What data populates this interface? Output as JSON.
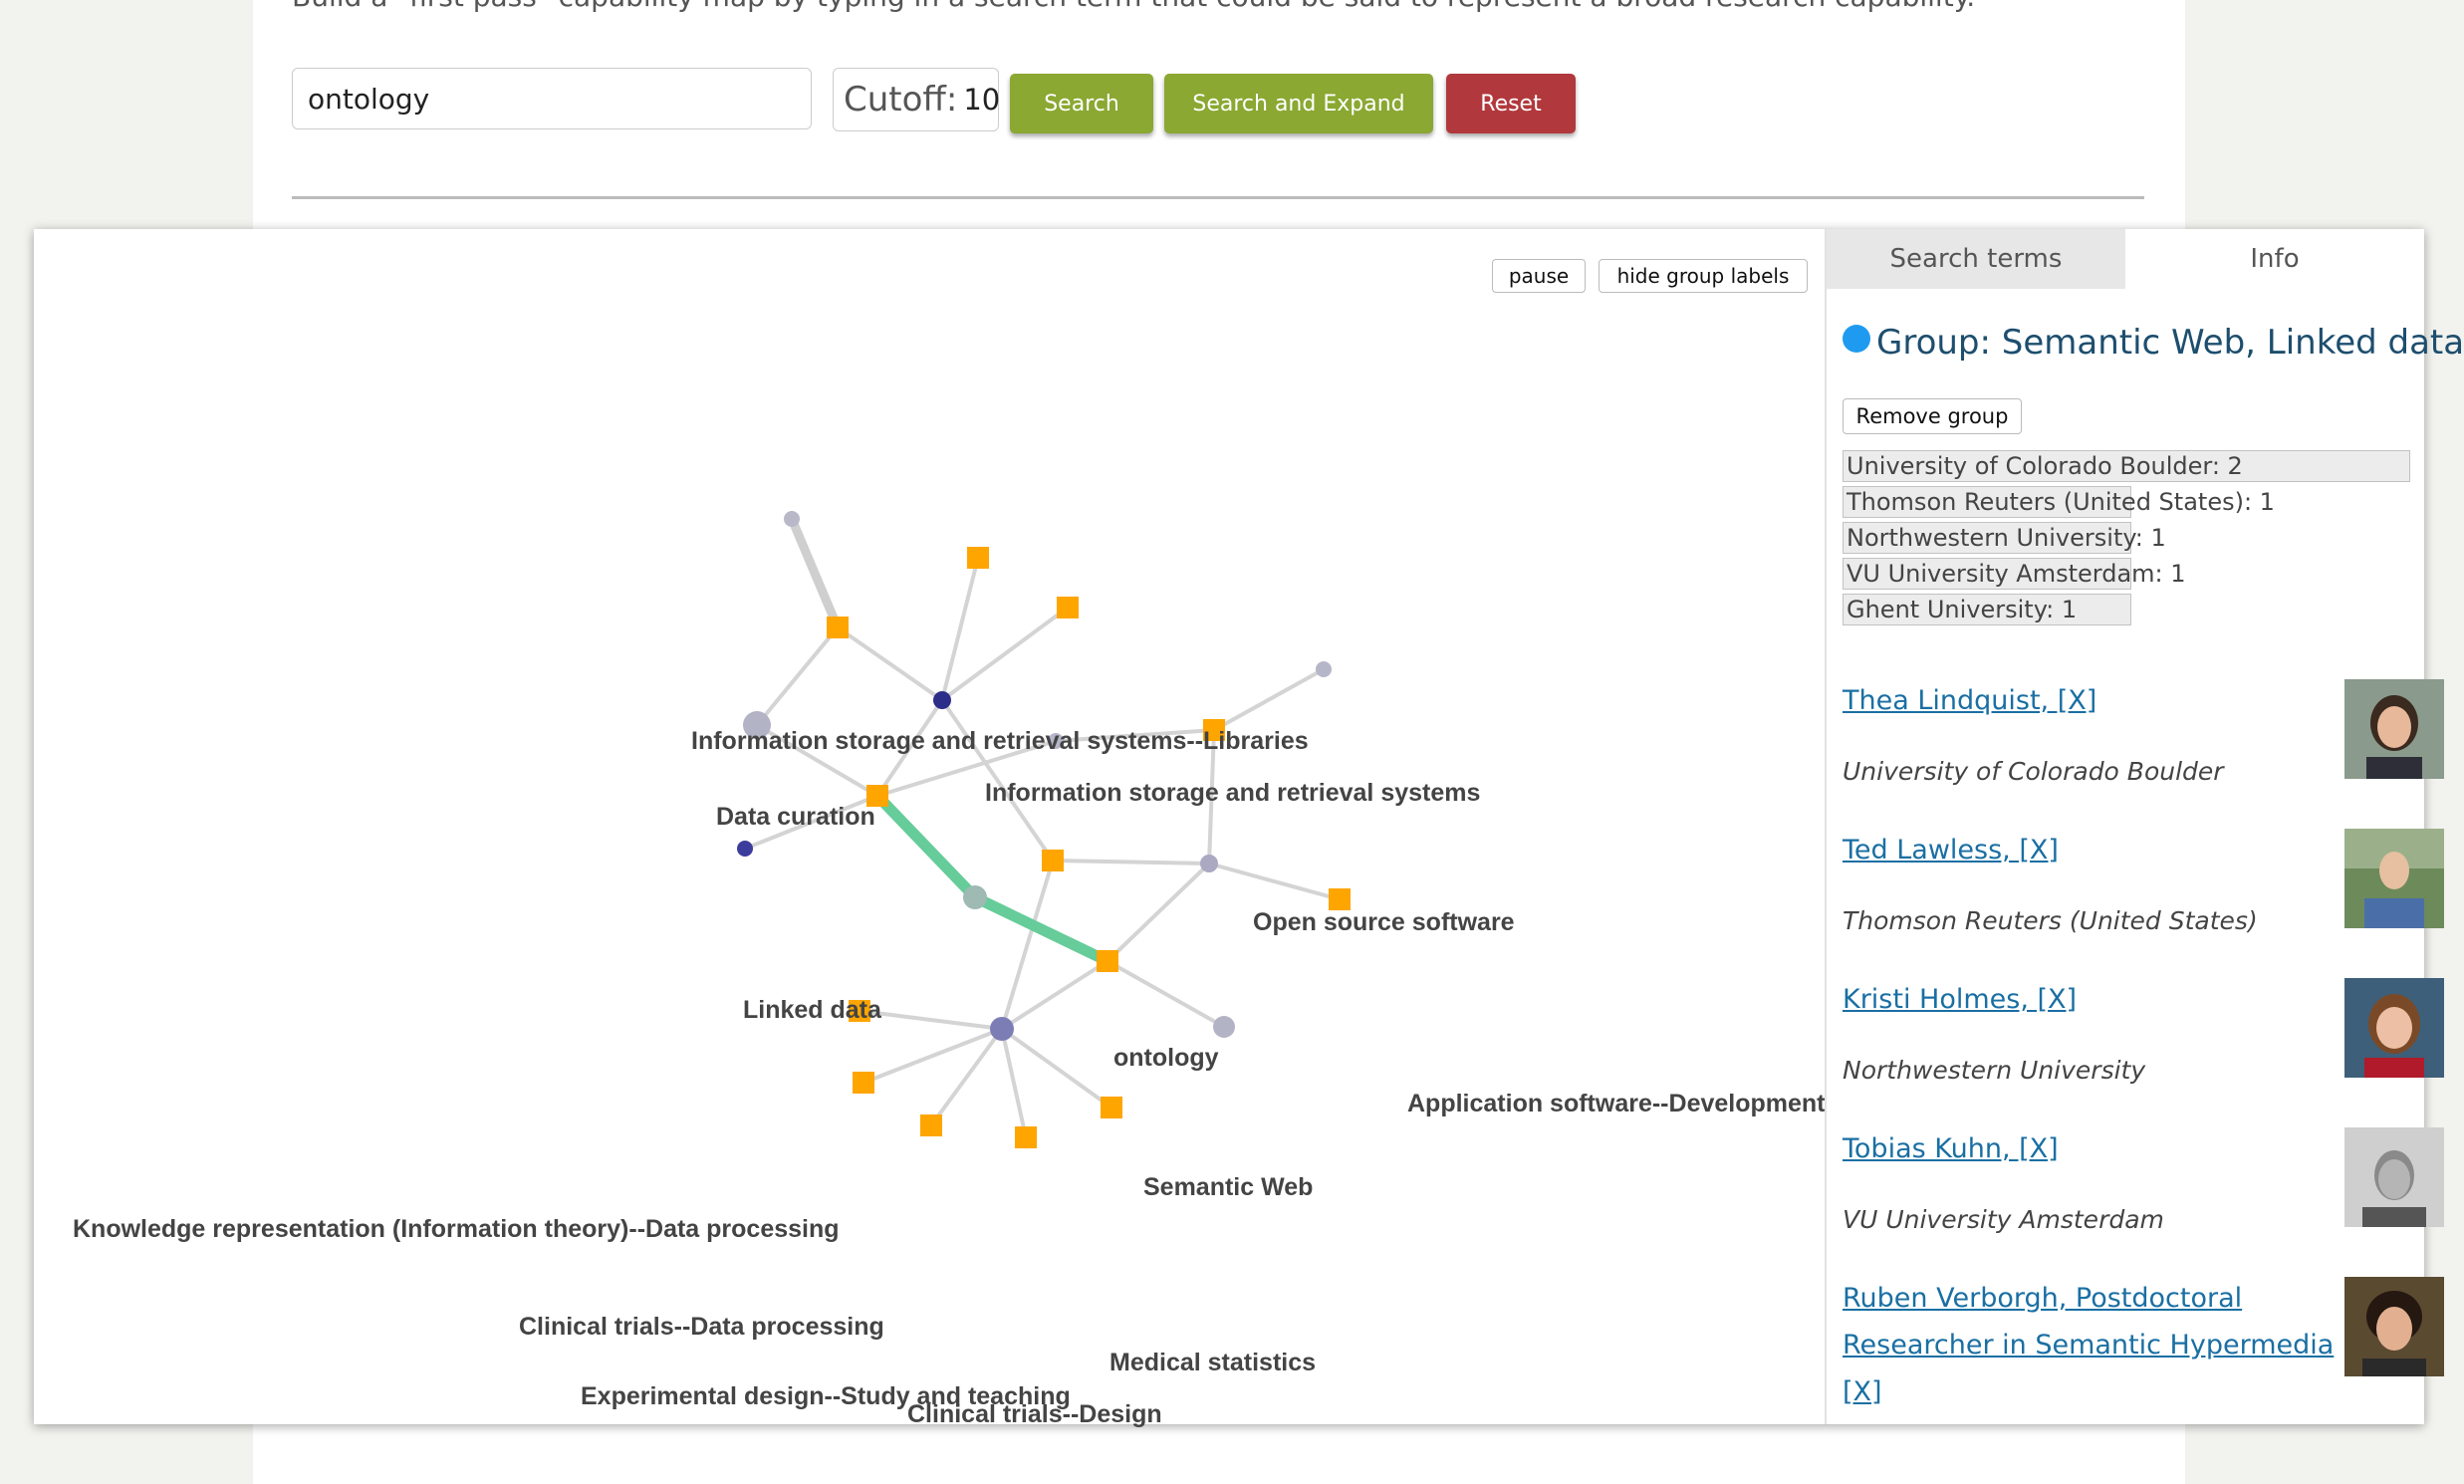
{
  "intro_text": "Build a \"first pass\" capability map by typing in a search term that could be said to represent a broad research capability.",
  "search": {
    "value": "ontology"
  },
  "cutoff": {
    "label": "Cutoff:",
    "value": "10"
  },
  "buttons": {
    "search": "Search",
    "search_expand": "Search and Expand",
    "reset": "Reset"
  },
  "colors": {
    "olive": "#8aa832",
    "red": "#b1383c",
    "orange": "#ffa500",
    "teal": "#66cc99",
    "group_blue": "#1e9bf0",
    "navy": "#2d2d8a"
  },
  "graph": {
    "pause": "pause",
    "hide_labels": "hide group labels",
    "labels": {
      "lbl1": "Information storage and retrieval systems--Libraries",
      "lbl2": "Data curation",
      "lbl3": "Information storage and retrieval systems",
      "lbl4": "Open source software",
      "lbl5": "Linked data",
      "lbl6": "ontology",
      "lbl7": "Application software--Development",
      "lbl8": "Semantic Web",
      "lbl9": "Knowledge representation (Information theory)--Data processing",
      "lbl10": "Clinical trials--Data processing",
      "lbl11": "Medical statistics",
      "lbl12": "Experimental design--Study and teaching",
      "lbl13": "Clinical trials--Design"
    }
  },
  "panel": {
    "tabs": {
      "terms": "Search terms",
      "info": "Info"
    },
    "group_title": "Group: Semantic Web, Linked data",
    "remove_group": "Remove group",
    "institutions": [
      {
        "text": "University of Colorado Boulder: 2",
        "share": 1.0
      },
      {
        "text": "Thomson Reuters (United States): 1",
        "share": 0.5
      },
      {
        "text": "Northwestern University: 1",
        "share": 0.5
      },
      {
        "text": "VU University Amsterdam: 1",
        "share": 0.5
      },
      {
        "text": "Ghent University: 1",
        "share": 0.5
      }
    ],
    "people": [
      {
        "name": "Thea Lindquist, [X]",
        "inst": "University of Colorado Boulder"
      },
      {
        "name": "Ted Lawless, [X]",
        "inst": "Thomson Reuters (United States)"
      },
      {
        "name": "Kristi Holmes, [X]",
        "inst": "Northwestern University"
      },
      {
        "name": "Tobias Kuhn, [X]",
        "inst": "VU University Amsterdam"
      },
      {
        "name_line1": "Ruben Verborgh, Postdoctoral",
        "name_line2": "Researcher in Semantic Hypermedia",
        "name_line3": "[X]"
      }
    ]
  }
}
